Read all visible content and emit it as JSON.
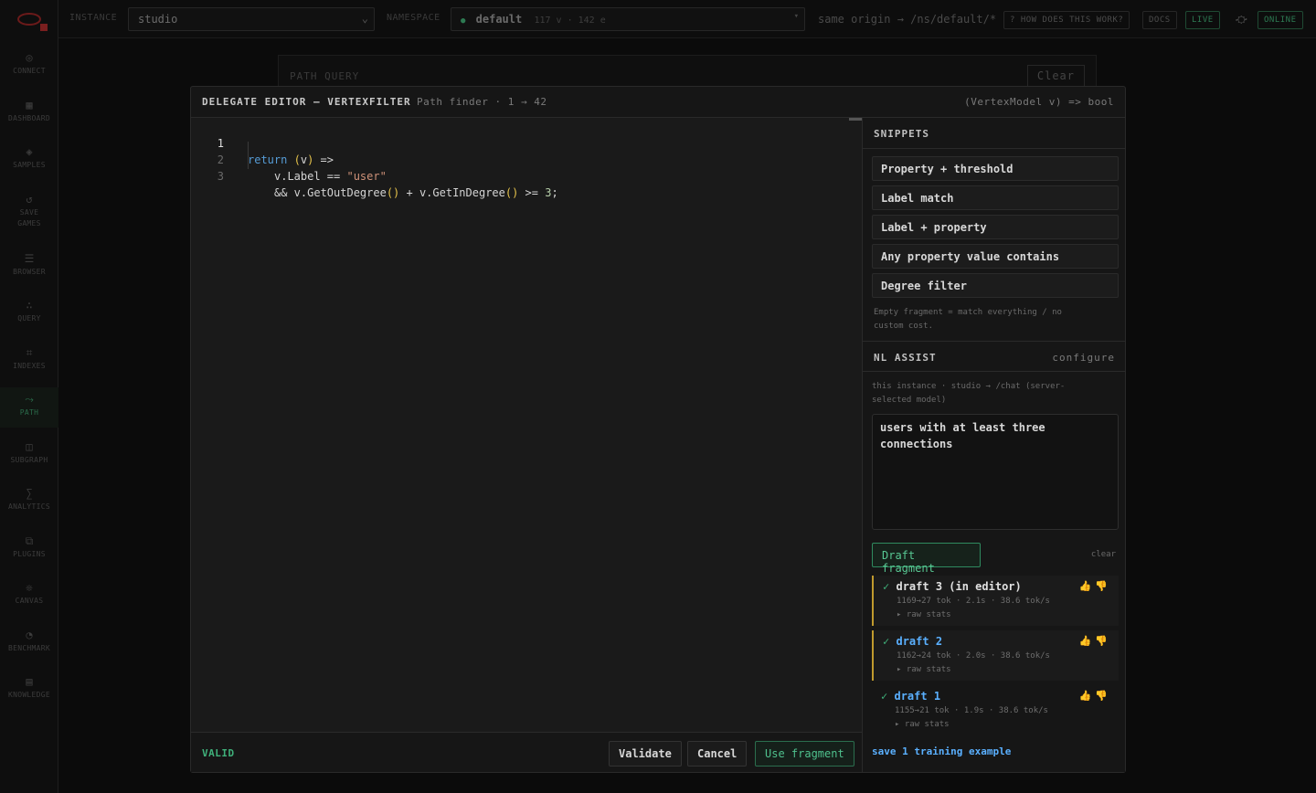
{
  "sidebar": {
    "items": [
      {
        "icon": "◎",
        "label": "CONNECT",
        "active": false
      },
      {
        "icon": "▦",
        "label": "DASHBOARD",
        "active": false
      },
      {
        "icon": "◈",
        "label": "SAMPLES",
        "active": false
      },
      {
        "icon": "↺",
        "label": "SAVE",
        "label2": "GAMES",
        "active": false
      },
      {
        "icon": "☰",
        "label": "BROWSER",
        "active": false
      },
      {
        "icon": "∴",
        "label": "QUERY",
        "active": false
      },
      {
        "icon": "⌗",
        "label": "INDEXES",
        "active": false
      },
      {
        "icon": "⤳",
        "label": "PATH",
        "active": true
      },
      {
        "icon": "◫",
        "label": "SUBGRAPH",
        "active": false
      },
      {
        "icon": "∑",
        "label": "ANALYTICS",
        "active": false
      },
      {
        "icon": "⧉",
        "label": "PLUGINS",
        "active": false
      },
      {
        "icon": "❊",
        "label": "CANVAS",
        "active": false
      },
      {
        "icon": "◔",
        "label": "BENCHMARK",
        "active": false
      },
      {
        "icon": "▤",
        "label": "KNOWLEDGE",
        "active": false
      }
    ]
  },
  "topbar": {
    "instance_label": "INSTANCE",
    "instance_value": "studio",
    "namespace_label": "NAMESPACE",
    "namespace_value": "default",
    "namespace_counts": "117 v · 142 e",
    "origin_text": "same origin → /ns/default/*",
    "help_button": "? HOW DOES THIS WORK?",
    "docs_button": "DOCS",
    "live_button": "LIVE",
    "online_badge": "ONLINE"
  },
  "background": {
    "panel_title": "PATH QUERY",
    "clear_button": "Clear"
  },
  "modal": {
    "title": "DELEGATE EDITOR — VERTEXFILTER",
    "subtitle": "Path finder · 1 → 42",
    "signature": "(VertexModel v) => bool",
    "code": {
      "ln1": "1",
      "ln2": "2",
      "ln3": "3",
      "l1_kw": "return",
      "l1_open": "(",
      "l1_var": "v",
      "l1_close": ")",
      "l1_arrow": " =>",
      "l2_pre": "v.Label == ",
      "l2_str": "\"user\"",
      "l3_pre": "&& v.GetOutDegree",
      "l3_p1": "()",
      "l3_mid": " + v.GetInDegree",
      "l3_p2": "()",
      "l3_post": " >= ",
      "l3_num": "3",
      "l3_end": ";"
    },
    "status": "VALID",
    "validate_button": "Validate",
    "cancel_button": "Cancel",
    "use_button": "Use fragment"
  },
  "snippets": {
    "heading": "SNIPPETS",
    "items": [
      "Property + threshold",
      "Label match",
      "Label + property",
      "Any property value contains",
      "Degree filter"
    ],
    "note_line1": "Empty fragment = match everything / no",
    "note_line2": "custom cost."
  },
  "nl_assist": {
    "heading": "NL ASSIST",
    "configure": "configure",
    "info_line1": "this instance · studio → /chat (server-",
    "info_line2": "selected model)",
    "prompt_line1": "users with at least three",
    "prompt_line2": "connections",
    "draft_button": "Draft fragment",
    "clear": "clear",
    "drafts": [
      {
        "check": "✓",
        "name": "draft 3 (in editor)",
        "stats": "1169→27 tok · 2.1s · 38.6 tok/s",
        "raw": "▸ raw stats"
      },
      {
        "check": "✓",
        "name": "draft 2",
        "stats": "1162→24 tok · 2.0s · 38.6 tok/s",
        "raw": "▸ raw stats"
      },
      {
        "check": "✓",
        "name": "draft 1",
        "stats": "1155→21 tok · 1.9s · 38.6 tok/s",
        "raw": "▸ raw stats"
      }
    ],
    "thumbs_up": "👍",
    "thumbs_down": "👎",
    "save_link": "save 1 training example"
  },
  "colors": {
    "accent_green": "#3fb07a",
    "link_blue": "#5ab0ff",
    "draft_marker": "#c09a2d"
  }
}
